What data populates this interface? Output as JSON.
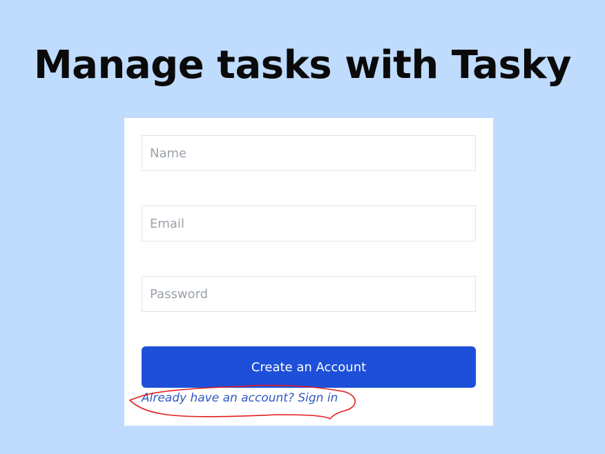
{
  "header": {
    "title": "Manage tasks with Tasky"
  },
  "form": {
    "name_placeholder": "Name",
    "email_placeholder": "Email",
    "password_placeholder": "Password",
    "submit_label": "Create an Account",
    "signin_link": "Already have an account? Sign in"
  },
  "colors": {
    "background": "#bfdbfe",
    "primary_button": "#1d4fd8",
    "link": "#2f56c4",
    "annotation": "#e01b1b"
  }
}
